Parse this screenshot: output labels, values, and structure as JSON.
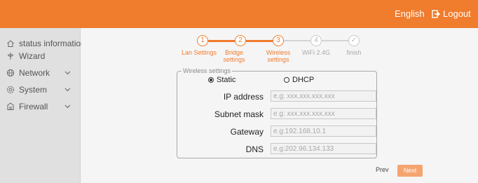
{
  "header": {
    "language": "English",
    "logout_label": "Logout",
    "accent_color": "#f07c2e"
  },
  "sidebar": {
    "items": [
      {
        "label": "status information",
        "icon": "home-icon",
        "expandable": false
      },
      {
        "label": "Wizard",
        "icon": "wizard-icon",
        "expandable": false
      },
      {
        "label": "Network",
        "icon": "globe-icon",
        "expandable": true
      },
      {
        "label": "System",
        "icon": "gear-icon",
        "expandable": true
      },
      {
        "label": "Firewall",
        "icon": "firewall-icon",
        "expandable": true
      }
    ]
  },
  "wizard": {
    "steps": [
      {
        "number": "1",
        "label": "Lan Settings",
        "state": "done"
      },
      {
        "number": "2",
        "label": "Bridge settings",
        "state": "done"
      },
      {
        "number": "3",
        "label": "Wireless settings",
        "state": "current"
      },
      {
        "number": "4",
        "label": "WiFi 2.4G",
        "state": "pending"
      },
      {
        "number": "✓",
        "label": "finish",
        "state": "pending"
      }
    ]
  },
  "wireless_settings": {
    "legend": "Wireless settings",
    "mode_options": [
      "Static",
      "DHCP"
    ],
    "selected_mode": "Static",
    "fields": [
      {
        "label": "IP address",
        "value": "",
        "placeholder": "e.g: xxx.xxx.xxx.xxx"
      },
      {
        "label": "Subnet mask",
        "value": "",
        "placeholder": "e.g: xxx.xxx.xxx.xxx"
      },
      {
        "label": "Gateway",
        "value": "",
        "placeholder": "e.g:192.168.10.1"
      },
      {
        "label": "DNS",
        "value": "",
        "placeholder": "e.g:202.96.134.133"
      }
    ]
  },
  "footer": {
    "prev_label": "Prev",
    "next_label": "Next"
  }
}
